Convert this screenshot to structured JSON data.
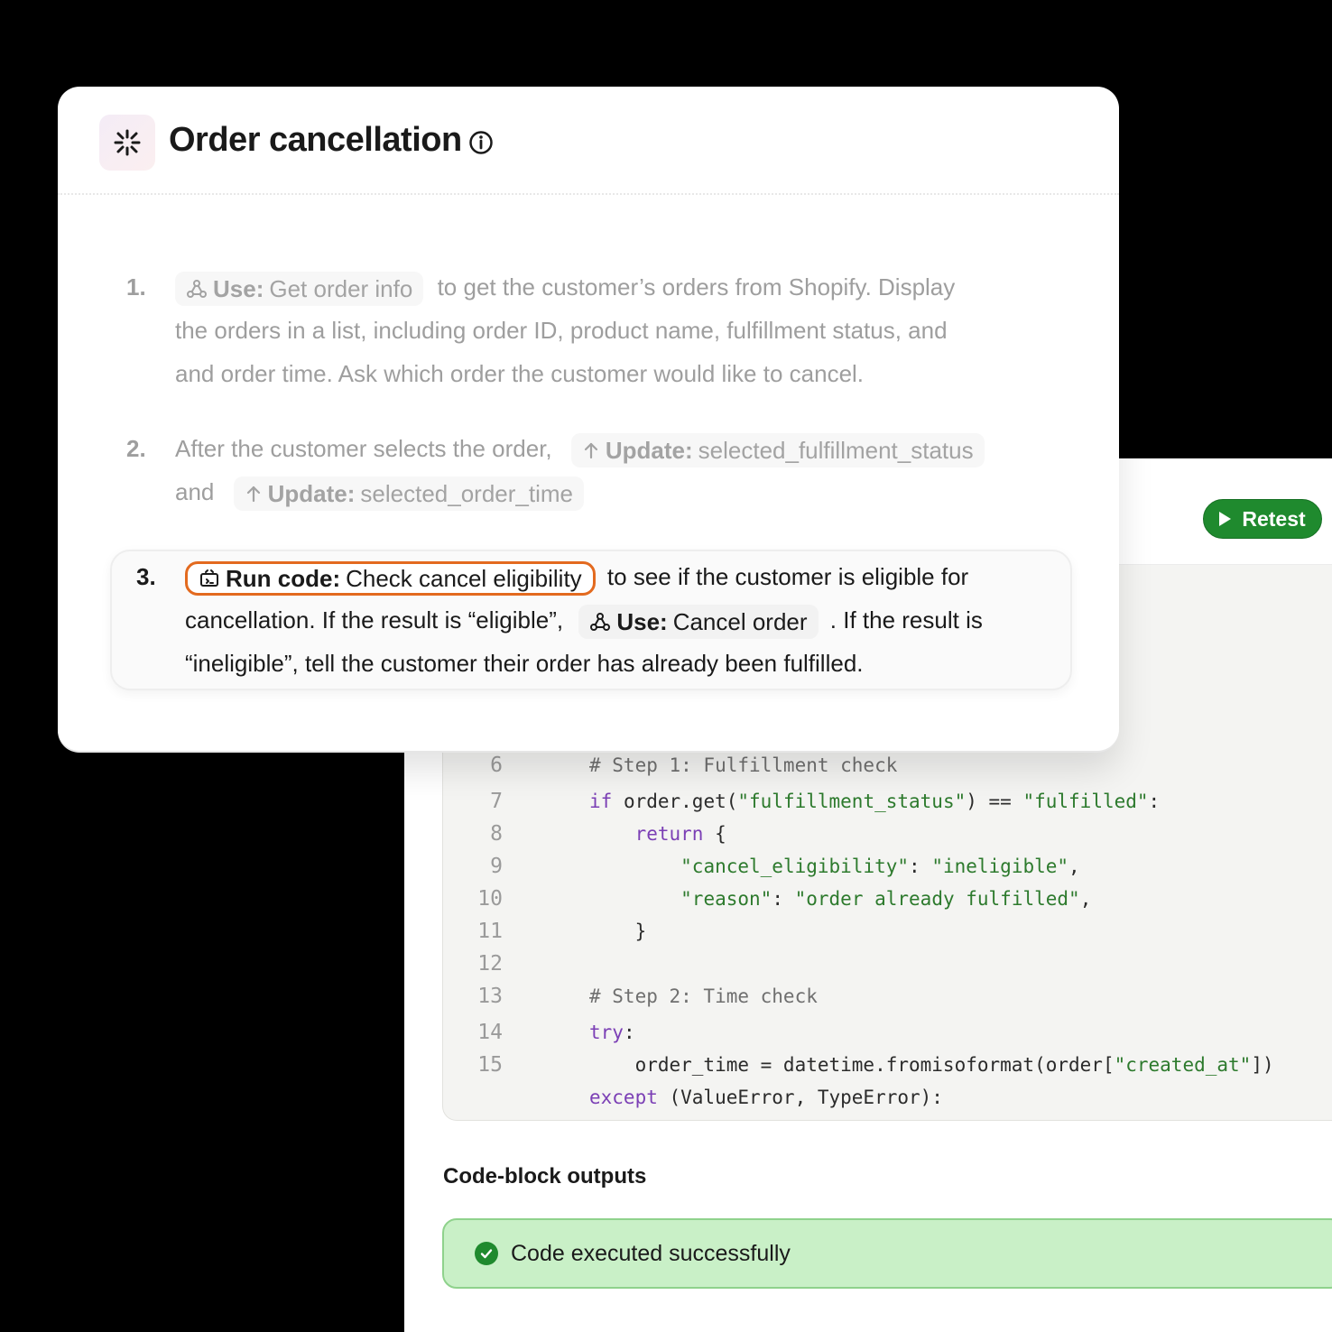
{
  "card": {
    "title": "Order cancellation",
    "steps": [
      {
        "number": "1.",
        "chip_label": "Use:",
        "chip_value": "Get order info",
        "line1": "to get the customer’s orders from Shopify. Display",
        "line2": "the orders in a list, including order ID, product name, fulfillment status, and",
        "line3": "and order time. Ask which order the customer would like to cancel."
      },
      {
        "number": "2.",
        "text_before": "After the customer selects the order,",
        "chip1_label": "Update:",
        "chip1_value": "selected_fulfillment_status",
        "text_and": "and",
        "chip2_label": "Update:",
        "chip2_value": "selected_order_time"
      },
      {
        "number": "3.",
        "chip1_label": "Run code:",
        "chip1_value": "Check cancel eligibility",
        "text_after1": "to see if the customer is eligible for",
        "text_line2": "cancellation. If the result is “eligible”,",
        "chip2_label": "Use:",
        "chip2_value": "Cancel order",
        "text_after2": ". If the result is",
        "text_line3": "“ineligible”, tell the customer their order has already been fulfilled."
      }
    ]
  },
  "editor": {
    "retest_label": "Retest",
    "lines": [
      {
        "n": "6",
        "parts": [
          {
            "t": "        "
          },
          {
            "t": "# Step 1: Fulfillment check",
            "c": "cm"
          }
        ]
      },
      {
        "n": "7",
        "parts": [
          {
            "t": "        "
          },
          {
            "t": "if",
            "c": "kw"
          },
          {
            "t": " order.get("
          },
          {
            "t": "\"fulfillment_status\"",
            "c": "str"
          },
          {
            "t": ") == "
          },
          {
            "t": "\"fulfilled\"",
            "c": "str"
          },
          {
            "t": ":"
          }
        ]
      },
      {
        "n": "8",
        "parts": [
          {
            "t": "            "
          },
          {
            "t": "return",
            "c": "kw"
          },
          {
            "t": " {"
          }
        ]
      },
      {
        "n": "9",
        "parts": [
          {
            "t": "                "
          },
          {
            "t": "\"cancel_eligibility\"",
            "c": "str"
          },
          {
            "t": ": "
          },
          {
            "t": "\"ineligible\"",
            "c": "str"
          },
          {
            "t": ","
          }
        ]
      },
      {
        "n": "10",
        "parts": [
          {
            "t": "                "
          },
          {
            "t": "\"reason\"",
            "c": "str"
          },
          {
            "t": ": "
          },
          {
            "t": "\"order already fulfilled\"",
            "c": "str"
          },
          {
            "t": ","
          }
        ]
      },
      {
        "n": "11",
        "parts": [
          {
            "t": "            }"
          }
        ]
      },
      {
        "n": "12",
        "parts": [
          {
            "t": ""
          }
        ]
      },
      {
        "n": "13",
        "parts": [
          {
            "t": "        "
          },
          {
            "t": "# Step 2: Time check",
            "c": "cm"
          }
        ]
      },
      {
        "n": "14",
        "parts": [
          {
            "t": "        "
          },
          {
            "t": "try",
            "c": "kw"
          },
          {
            "t": ":"
          }
        ]
      },
      {
        "n": "15",
        "parts": [
          {
            "t": "            order_time = datetime.fromisoformat(order["
          },
          {
            "t": "\"created_at\"",
            "c": "str"
          },
          {
            "t": "])"
          }
        ]
      },
      {
        "n": "",
        "parts": [
          {
            "t": "        "
          },
          {
            "t": "except",
            "c": "kw"
          },
          {
            "t": " (ValueError, TypeError):"
          }
        ]
      }
    ]
  },
  "outputs": {
    "title": "Code-block outputs",
    "status": "Code executed successfully"
  }
}
